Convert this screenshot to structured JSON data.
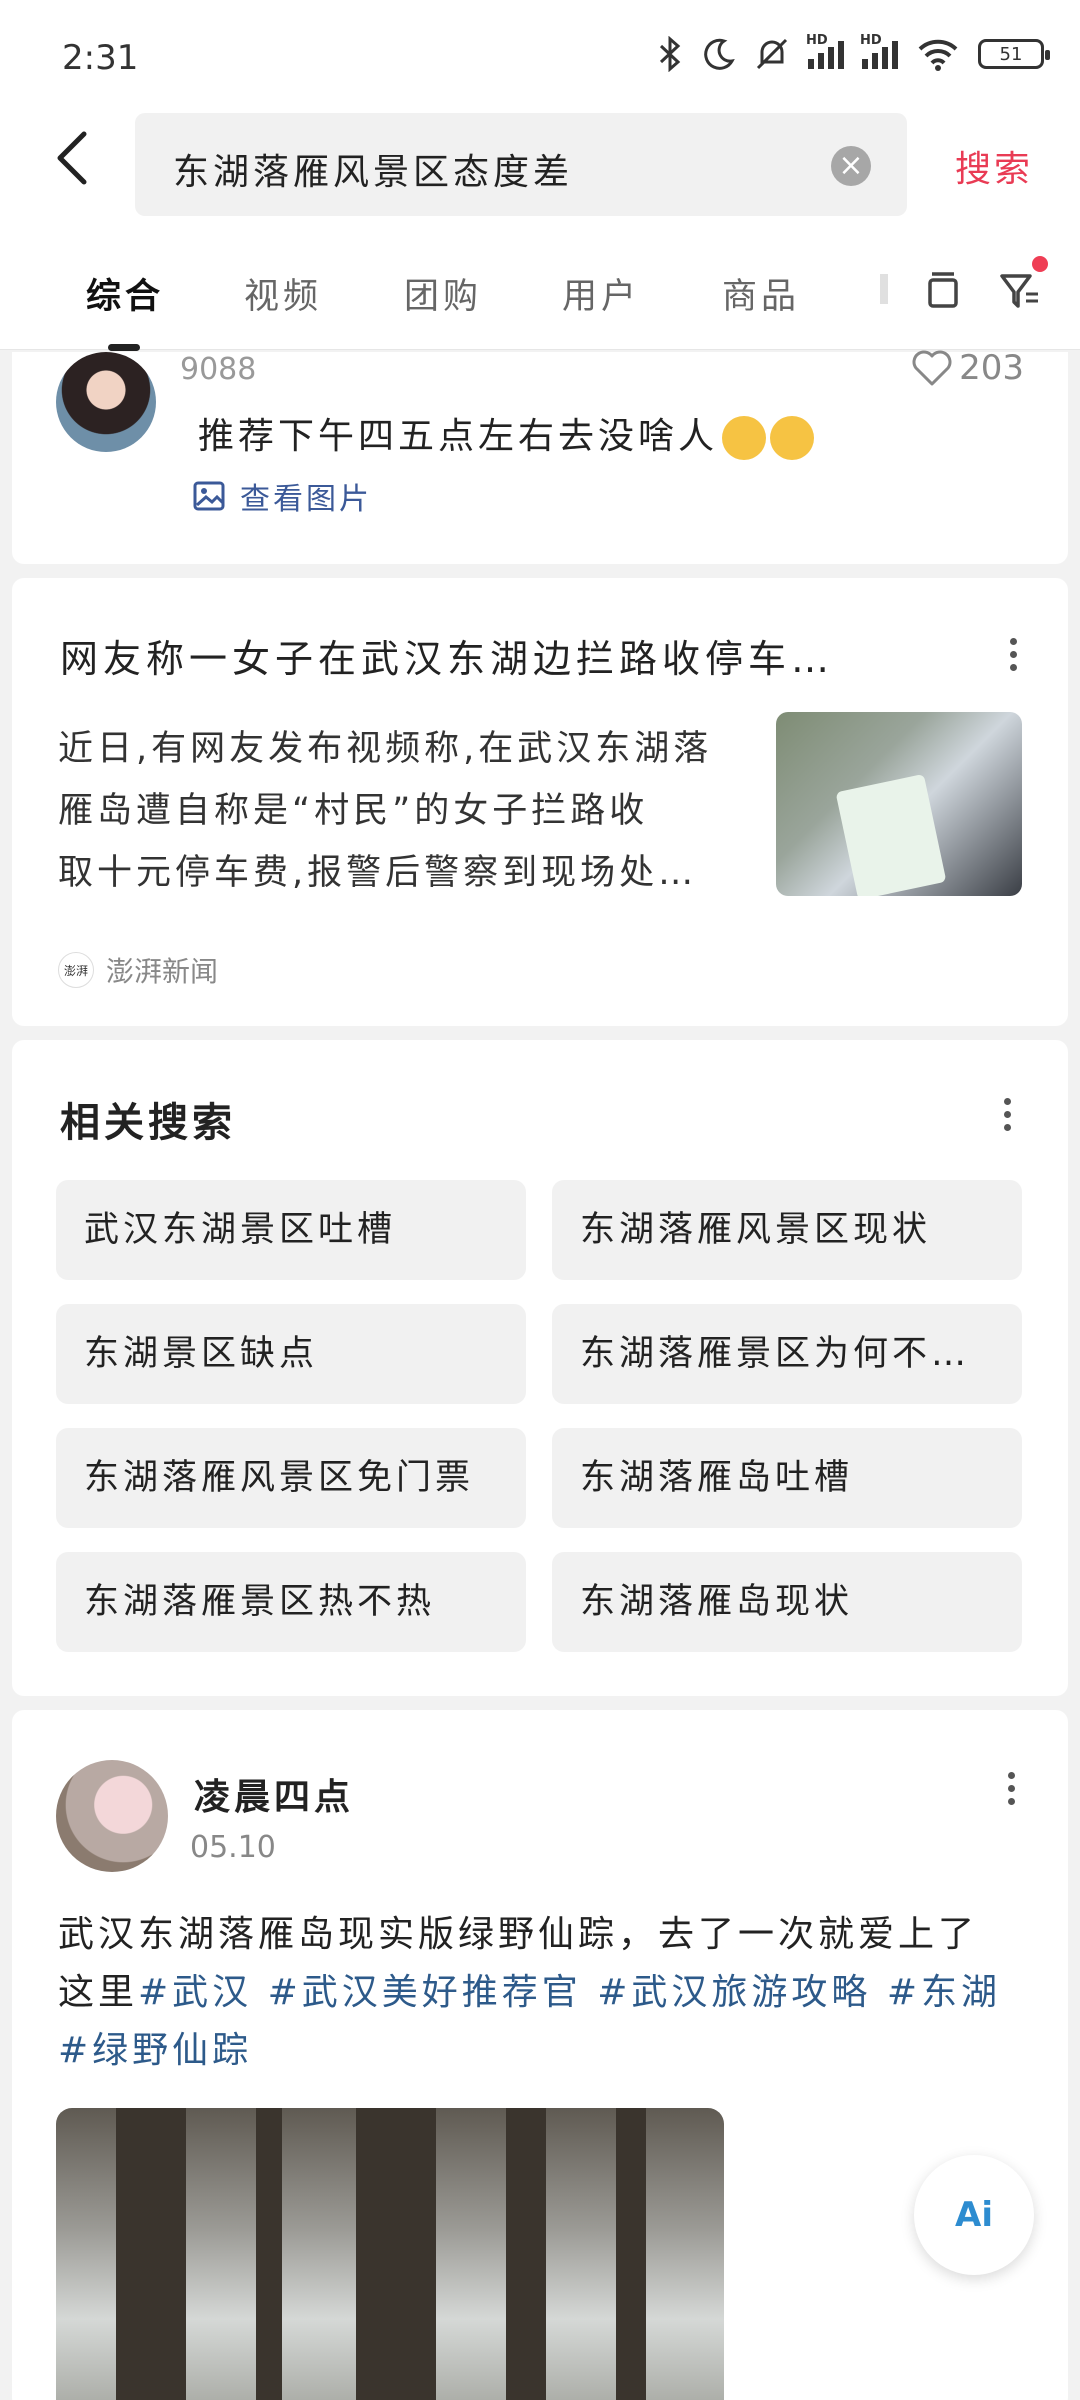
{
  "status_bar": {
    "time": "2:31",
    "battery": "51",
    "signal_label_1": "HD",
    "signal_label_2": "HD",
    "icons": [
      "bluetooth-icon",
      "moon-icon",
      "mute-icon",
      "signal-icon",
      "signal-icon",
      "wifi-icon",
      "battery-icon"
    ]
  },
  "search": {
    "query": "东湖落雁风景区态度差",
    "button": "搜索"
  },
  "tabs": [
    {
      "label": "综合",
      "active": true
    },
    {
      "label": "视频"
    },
    {
      "label": "团购"
    },
    {
      "label": "用户"
    },
    {
      "label": "商品"
    }
  ],
  "note_card": {
    "count": "9088",
    "likes": "203",
    "text": "推荐下午四五点左右去没啥人",
    "view_images": "查看图片"
  },
  "news_card": {
    "title": "网友称一女子在武汉东湖边拦路收停车…",
    "body_lines": [
      "近日,有网友发布视频称,在武汉东湖落",
      "雁岛遭自称是“村民”的女子拦路收",
      "取十元停车费,报警后警察到现场处…"
    ],
    "source_logo": "澎湃",
    "source": "澎湃新闻"
  },
  "related": {
    "title": "相关搜索",
    "items": [
      "武汉东湖景区吐槽",
      "东湖落雁风景区现状",
      "东湖景区缺点",
      "东湖落雁景区为何不…",
      "东湖落雁风景区免门票",
      "东湖落雁岛吐槽",
      "东湖落雁景区热不热",
      "东湖落雁岛现状"
    ]
  },
  "post": {
    "username": "凌晨四点",
    "date": "05.10",
    "text_line1": "武汉东湖落雁岛现实版绿野仙踪，去了一次就爱上了",
    "text_line2_prefix": "这里",
    "tags": [
      "#武汉",
      "#武汉美好推荐官",
      "#武汉旅游攻略",
      "#东湖",
      "#绿野仙踪"
    ]
  },
  "ai_button": "Ai"
}
